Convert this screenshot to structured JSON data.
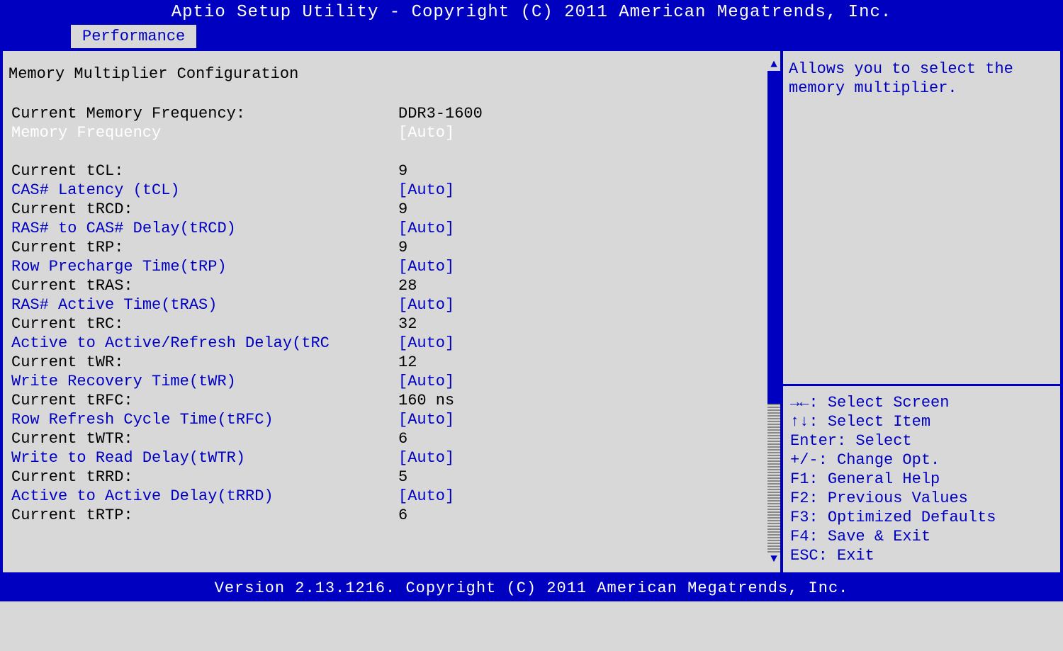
{
  "header": {
    "title": "Aptio Setup Utility - Copyright (C) 2011 American Megatrends, Inc."
  },
  "tab": {
    "label": "Performance"
  },
  "section": {
    "title": "Memory Multiplier Configuration"
  },
  "settings": [
    {
      "label": "Current Memory Frequency:",
      "value": "DDR3-1600",
      "type": "readonly"
    },
    {
      "label": "Memory Frequency",
      "value": "[Auto]",
      "type": "selected"
    },
    {
      "label": "",
      "value": "",
      "type": "spacer"
    },
    {
      "label": "Current tCL:",
      "value": "9",
      "type": "readonly"
    },
    {
      "label": "CAS# Latency (tCL)",
      "value": "[Auto]",
      "type": "editable"
    },
    {
      "label": "Current tRCD:",
      "value": "9",
      "type": "readonly"
    },
    {
      "label": "RAS# to CAS# Delay(tRCD)",
      "value": "[Auto]",
      "type": "editable"
    },
    {
      "label": "Current tRP:",
      "value": "9",
      "type": "readonly"
    },
    {
      "label": "Row Precharge Time(tRP)",
      "value": "[Auto]",
      "type": "editable"
    },
    {
      "label": "Current tRAS:",
      "value": "28",
      "type": "readonly"
    },
    {
      "label": "RAS# Active Time(tRAS)",
      "value": "[Auto]",
      "type": "editable"
    },
    {
      "label": "Current tRC:",
      "value": "32",
      "type": "readonly"
    },
    {
      "label": "Active to Active/Refresh Delay(tRC",
      "value": "[Auto]",
      "type": "editable"
    },
    {
      "label": "Current tWR:",
      "value": "12",
      "type": "readonly"
    },
    {
      "label": "Write Recovery Time(tWR)",
      "value": "[Auto]",
      "type": "editable"
    },
    {
      "label": "Current tRFC:",
      "value": "160 ns",
      "type": "readonly"
    },
    {
      "label": "Row Refresh Cycle Time(tRFC)",
      "value": "[Auto]",
      "type": "editable"
    },
    {
      "label": "Current tWTR:",
      "value": "6",
      "type": "readonly"
    },
    {
      "label": "Write to Read Delay(tWTR)",
      "value": "[Auto]",
      "type": "editable"
    },
    {
      "label": "Current tRRD:",
      "value": "5",
      "type": "readonly"
    },
    {
      "label": "Active to Active Delay(tRRD)",
      "value": "[Auto]",
      "type": "editable"
    },
    {
      "label": "Current tRTP:",
      "value": "6",
      "type": "readonly"
    }
  ],
  "help": {
    "text": "Allows you to select the memory multiplier."
  },
  "keys": [
    {
      "key": "→←",
      "action": "Select Screen"
    },
    {
      "key": "↑↓",
      "action": "Select Item"
    },
    {
      "key": "Enter",
      "action": "Select"
    },
    {
      "key": "+/-",
      "action": "Change Opt."
    },
    {
      "key": "F1",
      "action": "General Help"
    },
    {
      "key": "F2",
      "action": "Previous Values"
    },
    {
      "key": "F3",
      "action": "Optimized Defaults"
    },
    {
      "key": "F4",
      "action": "Save & Exit"
    },
    {
      "key": "ESC",
      "action": "Exit"
    }
  ],
  "footer": {
    "text": "Version 2.13.1216. Copyright (C) 2011 American Megatrends, Inc."
  }
}
